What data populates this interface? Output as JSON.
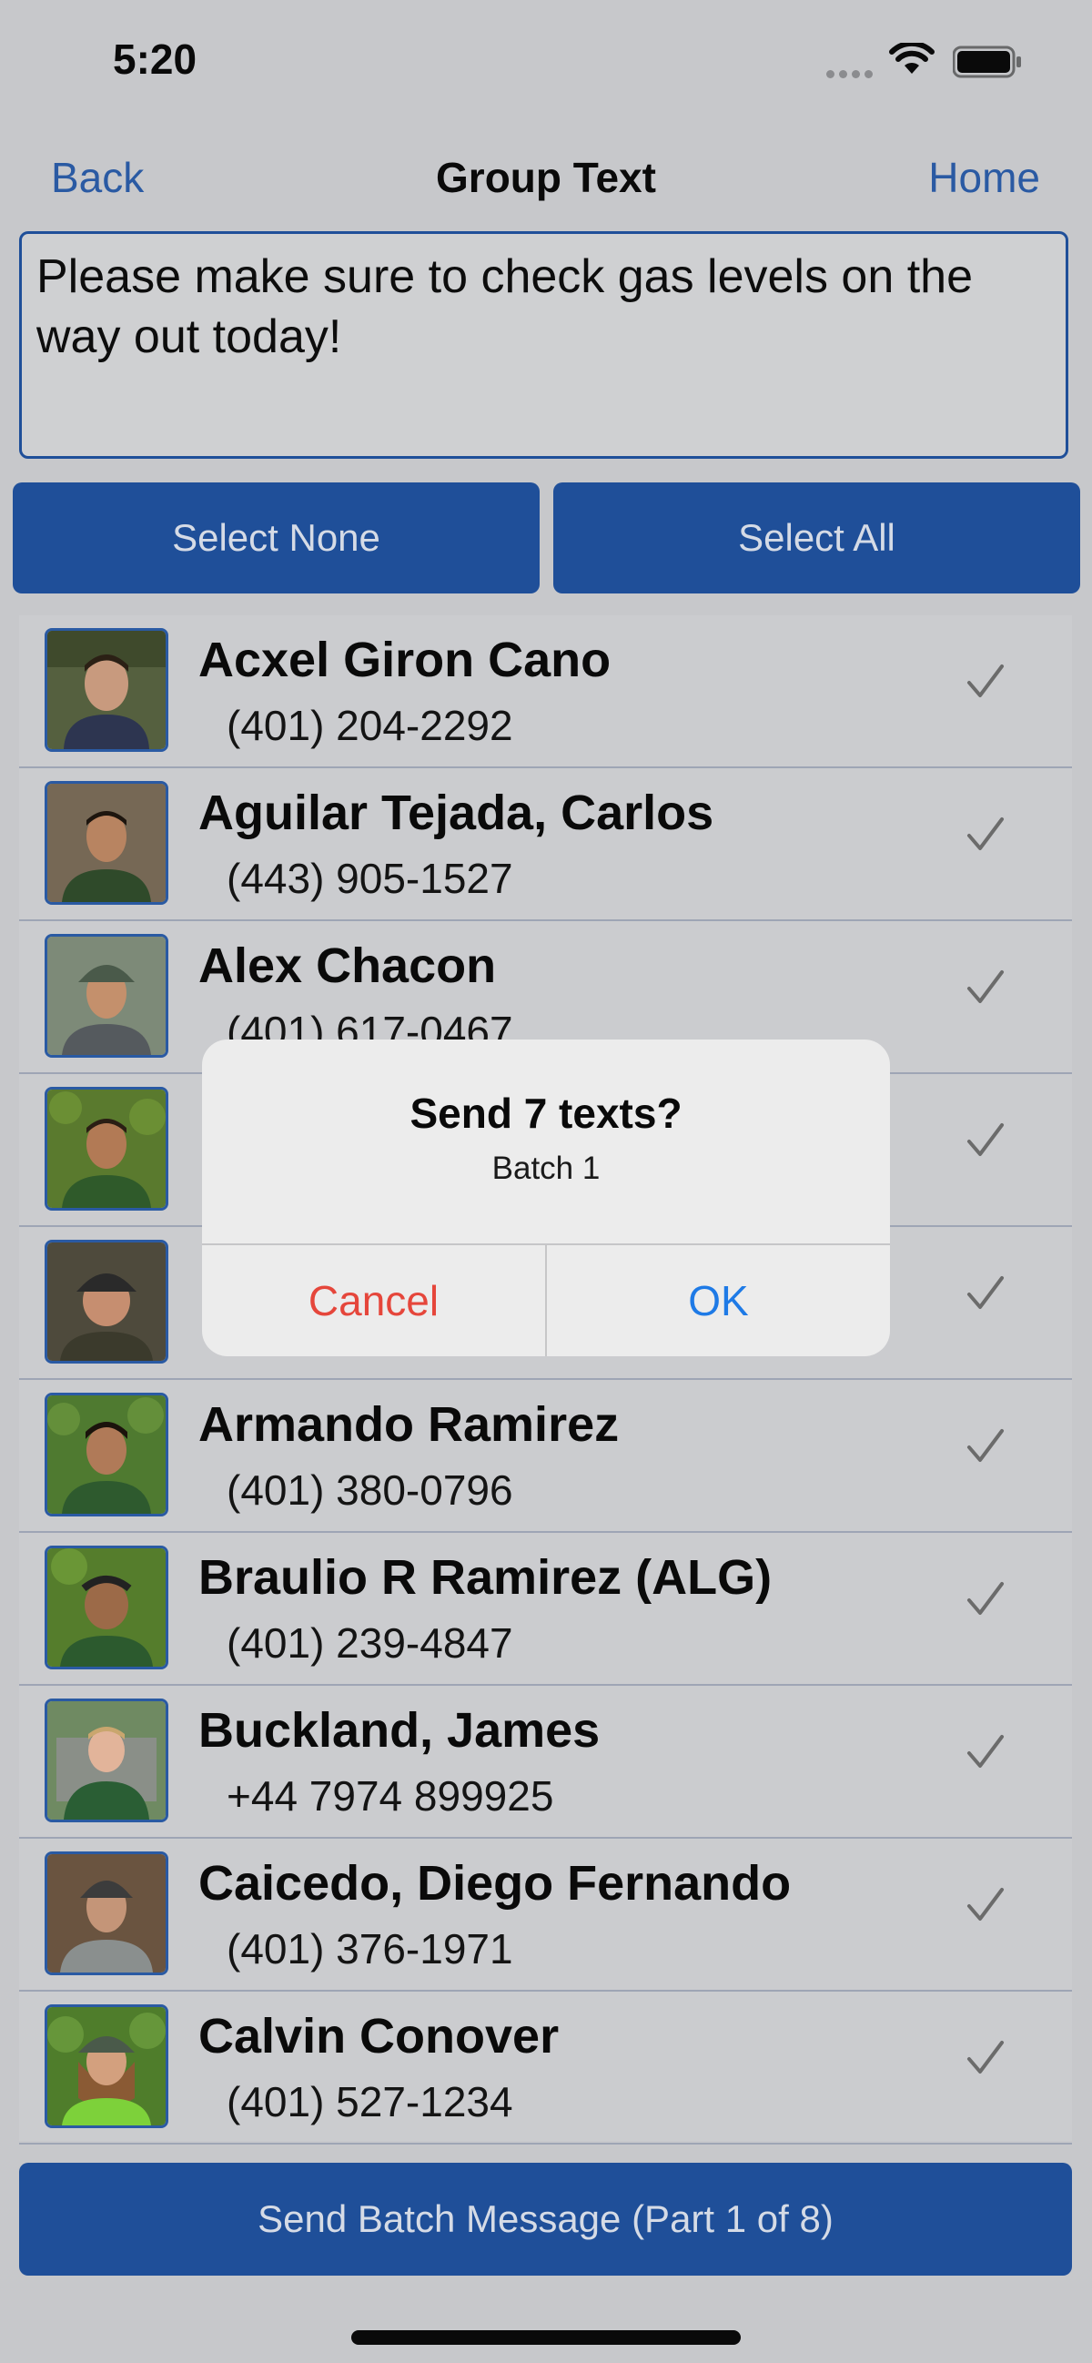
{
  "status_bar": {
    "time": "5:20"
  },
  "nav": {
    "back_label": "Back",
    "title": "Group Text",
    "home_label": "Home"
  },
  "message": {
    "text": "Please make sure to check gas levels on the way out today!"
  },
  "buttons": {
    "select_none": "Select None",
    "select_all": "Select All",
    "send_batch": "Send Batch Message (Part 1 of 8)"
  },
  "contacts": [
    {
      "name": "Acxel Giron Cano",
      "phone": "(401) 204-2292",
      "selected": true
    },
    {
      "name": "Aguilar Tejada, Carlos",
      "phone": "(443) 905-1527",
      "selected": true
    },
    {
      "name": "Alex Chacon",
      "phone": "(401) 617-0467",
      "selected": true
    },
    {
      "name": "",
      "phone": "",
      "selected": true
    },
    {
      "name": "",
      "phone": "",
      "selected": true
    },
    {
      "name": "Armando Ramirez",
      "phone": "(401) 380-0796",
      "selected": true
    },
    {
      "name": "Braulio R Ramirez (ALG)",
      "phone": "(401) 239-4847",
      "selected": true
    },
    {
      "name": "Buckland, James",
      "phone": "+44 7974 899925",
      "selected": true
    },
    {
      "name": "Caicedo, Diego Fernando",
      "phone": "(401) 376-1971",
      "selected": true
    },
    {
      "name": "Calvin Conover",
      "phone": "(401) 527-1234",
      "selected": true
    }
  ],
  "alert": {
    "title": "Send 7 texts?",
    "message": "Batch 1",
    "cancel_label": "Cancel",
    "ok_label": "OK"
  },
  "colors": {
    "accent": "#1f4f99",
    "link": "#2a5aa3",
    "cancel": "#e5463b",
    "ok": "#1e7ae6",
    "check": "#6b6b6b"
  },
  "icons": {
    "check": "checkmark-icon",
    "wifi": "wifi-icon",
    "battery": "battery-icon",
    "signal": "cellular-signal-icon"
  }
}
